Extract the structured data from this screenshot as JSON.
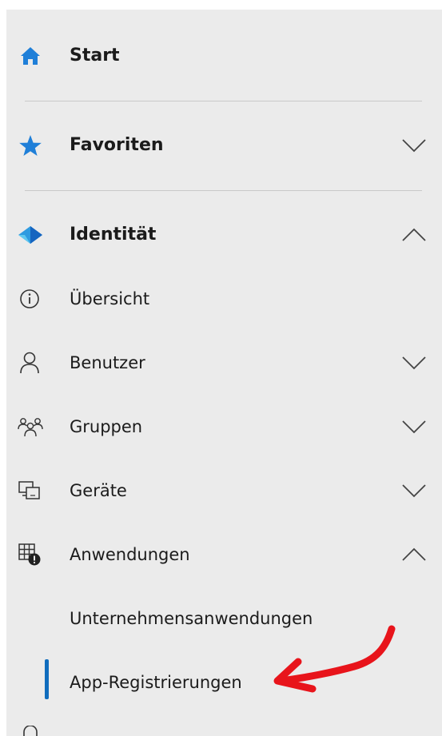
{
  "nav": {
    "start": "Start",
    "favoriten": "Favoriten",
    "identitaet": "Identität",
    "uebersicht": "Übersicht",
    "benutzer": "Benutzer",
    "gruppen": "Gruppen",
    "geraete": "Geräte",
    "anwendungen": "Anwendungen",
    "unternehmensanwendungen": "Unternehmensanwendungen",
    "app_registrierungen": "App-Registrierungen"
  },
  "colors": {
    "accent": "#0f6cbd",
    "annotation_arrow": "#e8141b",
    "panel_bg": "#ebebeb"
  },
  "icons": {
    "start": "home-icon",
    "favoriten": "star-icon",
    "identitaet": "identity-diamond-icon",
    "uebersicht": "info-icon",
    "benutzer": "person-icon",
    "gruppen": "group-icon",
    "geraete": "devices-icon",
    "anwendungen": "applications-icon"
  },
  "state": {
    "selected_item": "App-Registrierungen",
    "expanded": [
      "Identität",
      "Anwendungen"
    ]
  }
}
